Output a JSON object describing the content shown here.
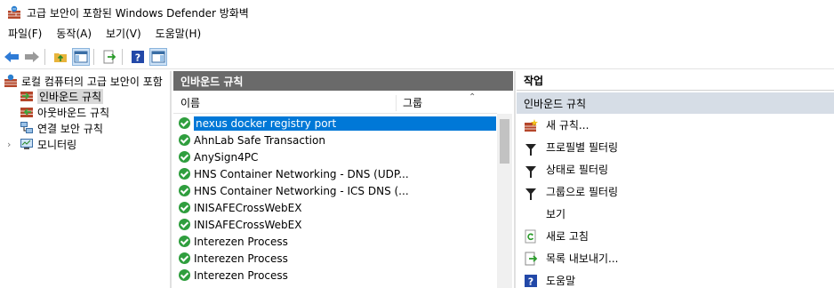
{
  "window": {
    "title": "고급 보안이 포함된 Windows Defender 방화벽"
  },
  "menu": [
    {
      "label": "파일(F)"
    },
    {
      "label": "동작(A)"
    },
    {
      "label": "보기(V)"
    },
    {
      "label": "도움말(H)"
    }
  ],
  "toolbar": {
    "icons": [
      "back-arrow-icon",
      "forward-arrow-icon",
      "folder-up-icon",
      "show-hide-console-tree-icon",
      "export-list-icon",
      "help-icon",
      "action-pane-icon"
    ]
  },
  "tree": {
    "root": "로컬 컴퓨터의 고급 보안이 포함",
    "items": [
      {
        "label": "인바운드 규칙",
        "selected": true
      },
      {
        "label": "아웃바운드 규칙"
      },
      {
        "label": "연결 보안 규칙"
      },
      {
        "label": "모니터링"
      }
    ]
  },
  "list": {
    "header": "인바운드 규칙",
    "columns": {
      "name": "이름",
      "group": "그룹"
    },
    "rows": [
      {
        "name": "nexus docker registry port",
        "selected": true
      },
      {
        "name": "AhnLab Safe Transaction"
      },
      {
        "name": "AnySign4PC"
      },
      {
        "name": "HNS Container Networking - DNS (UDP..."
      },
      {
        "name": "HNS Container Networking - ICS DNS (..."
      },
      {
        "name": "INISAFECrossWebEX"
      },
      {
        "name": "INISAFECrossWebEX"
      },
      {
        "name": "Interezen Process"
      },
      {
        "name": "Interezen Process"
      },
      {
        "name": "Interezen Process"
      }
    ]
  },
  "actions": {
    "header": "작업",
    "section": "인바운드 규칙",
    "items": [
      {
        "label": "새 규칙...",
        "icon": "new-rule-icon"
      },
      {
        "label": "프로필별 필터링",
        "icon": "filter-icon"
      },
      {
        "label": "상태로 필터링",
        "icon": "filter-icon"
      },
      {
        "label": "그룹으로 필터링",
        "icon": "filter-icon"
      },
      {
        "label": "보기",
        "icon": ""
      },
      {
        "label": "새로 고침",
        "icon": "refresh-icon"
      },
      {
        "label": "목록 내보내기...",
        "icon": "export-list-icon"
      },
      {
        "label": "도움말",
        "icon": "help-icon"
      }
    ]
  },
  "colors": {
    "selection": "#0078d7",
    "header": "#6a6a6a",
    "section": "#d6dde6",
    "status_enabled": "#2f9e3e"
  }
}
